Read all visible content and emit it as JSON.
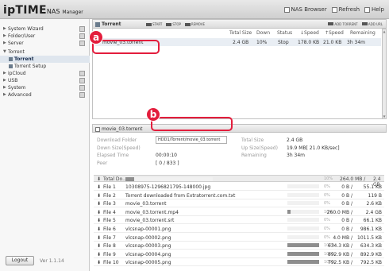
{
  "app": {
    "logo_main": "ipTIME",
    "logo_sub": "NAS",
    "logo_manager": "Manager"
  },
  "header": {
    "links": [
      "NAS Browser",
      "Refresh",
      "Help"
    ]
  },
  "sidebar": {
    "items": [
      {
        "label": "System Wizard",
        "arrow": "▶"
      },
      {
        "label": "Folder/User",
        "arrow": "▶"
      },
      {
        "label": "Server",
        "arrow": "▶"
      },
      {
        "label": "Torrent",
        "arrow": "▼"
      },
      {
        "label": "Torrent",
        "sub": true,
        "active": true
      },
      {
        "label": "Torrent Setup",
        "sub": true
      },
      {
        "label": "ipCloud",
        "arrow": "▶"
      },
      {
        "label": "USB",
        "arrow": "▶"
      },
      {
        "label": "System",
        "arrow": "▶"
      },
      {
        "label": "Advanced",
        "arrow": "▶"
      }
    ],
    "logout_label": "Logout",
    "version": "Ver 1.1.14"
  },
  "toolbar": {
    "title": "Torrent",
    "buttons": [
      "START",
      "STOP",
      "REMOVE"
    ],
    "right_buttons": [
      "ADD TORRENT",
      "ADD URL"
    ]
  },
  "torrent_table": {
    "headers": [
      "Total Size",
      "Down",
      "Status",
      "↓Speed",
      "↑Speed",
      "Remaining"
    ],
    "rows": [
      {
        "name": "movie_03.torrent",
        "size": "2.4 GB",
        "down": "10%",
        "status": "Stop",
        "down_speed": "178.0 KB",
        "up_speed": "21.0 KB",
        "remaining": "3h 34m"
      }
    ]
  },
  "detail": {
    "title": "movie_03.torrent",
    "download_folder_label": "Download Folder",
    "download_folder_value": "HDD1/Torrent/movie_03.torrent",
    "down_size_label": "Down Size(Speed)",
    "elapsed_label": "Elapsed Time",
    "elapsed_value": "00:00:10",
    "peer_label": "Peer",
    "peer_value": "[ 0 / 833 ]",
    "total_size_label": "Total Size",
    "total_size_value": "2.4 GB",
    "up_size_label": "Up Size(Speed)",
    "up_size_value": "19.9 MB[ 21.0 KB/sec]",
    "remaining_label": "Remaining",
    "remaining_value": "3h 34m"
  },
  "files": {
    "total_label": "Total Do...",
    "total_pct": "10%",
    "total_size": "264.0 MB /",
    "total_full": "2.4 GB",
    "total_progress": 0.1,
    "rows": [
      {
        "index": "File 1",
        "name": "10308975-1296821795-148000.jpg",
        "pct": "0%",
        "progress": 0.0,
        "down": "0 B /",
        "size": "55.1 KB"
      },
      {
        "index": "File 2",
        "name": "Torrent downloaded from Extratorrent.com.txt",
        "pct": "0%",
        "progress": 0.0,
        "down": "0 B /",
        "size": "119 B"
      },
      {
        "index": "File 3",
        "name": "movie_03.torrent",
        "pct": "0%",
        "progress": 0.0,
        "down": "0 B /",
        "size": "2.6 KB"
      },
      {
        "index": "File 4",
        "name": "movie_03.torrent.mp4",
        "pct": "10%",
        "progress": 0.1,
        "down": "260.0 MB /",
        "size": "2.4 GB"
      },
      {
        "index": "File 5",
        "name": "movie_03.torrent.srt",
        "pct": "0%",
        "progress": 0.0,
        "down": "0 B /",
        "size": "66.1 KB"
      },
      {
        "index": "File 6",
        "name": "vlcsnap-00001.png",
        "pct": "0%",
        "progress": 0.0,
        "down": "0 B /",
        "size": "986.1 KB"
      },
      {
        "index": "File 7",
        "name": "vlcsnap-00002.png",
        "pct": "0%",
        "progress": 0.0,
        "down": "4.0 MB /",
        "size": "1011.5 KB"
      },
      {
        "index": "File 8",
        "name": "vlcsnap-00003.png",
        "pct": "100%",
        "progress": 1.0,
        "down": "634.3 KB /",
        "size": "634.3 KB"
      },
      {
        "index": "File 9",
        "name": "vlcsnap-00004.png",
        "pct": "100%",
        "progress": 1.0,
        "down": "892.9 KB /",
        "size": "892.9 KB"
      },
      {
        "index": "File 10",
        "name": "vlcsnap-00005.png",
        "pct": "100%",
        "progress": 1.0,
        "down": "792.5 KB /",
        "size": "792.5 KB"
      }
    ]
  },
  "callouts": {
    "a": "a",
    "b": "b"
  },
  "colors": {
    "accent": "#e31d3c",
    "row_highlight": "#e9eef4"
  }
}
